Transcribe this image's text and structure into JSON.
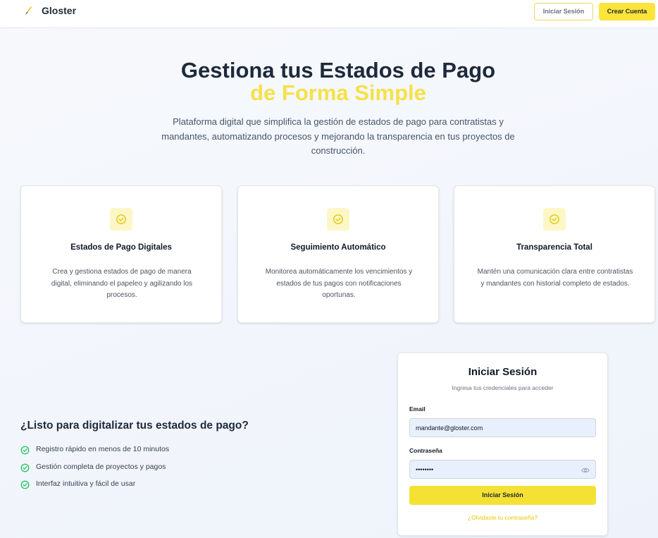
{
  "header": {
    "brand": "Gloster",
    "login_label": "Iniciar Sesión",
    "register_label": "Crear Cuenta"
  },
  "hero": {
    "title_line1": "Gestiona tus Estados de Pago",
    "title_line2": "de Forma Simple",
    "description": "Plataforma digital que simplifica la gestión de estados de pago para contratistas y mandantes, automatizando procesos y mejorando la transparencia en tus proyectos de construcción."
  },
  "features": [
    {
      "icon": "check-circle-icon",
      "title": "Estados de Pago Digitales",
      "description": "Crea y gestiona estados de pago de manera digital, eliminando el papeleo y agilizando los procesos."
    },
    {
      "icon": "check-circle-icon",
      "title": "Seguimiento Automático",
      "description": "Monitorea automáticamente los vencimientos y estados de tus pagos con notificaciones oportunas."
    },
    {
      "icon": "check-circle-icon",
      "title": "Transparencia Total",
      "description": "Mantén una comunicación clara entre contratistas y mandantes con historial completo de estados."
    }
  ],
  "cta": {
    "title": "¿Listo para digitalizar tus estados de pago?",
    "items": [
      "Registro rápido en menos de 10 minutos",
      "Gestión completa de proyectos y pagos",
      "Interfaz intuitiva y fácil de usar"
    ]
  },
  "login": {
    "title": "Iniciar Sesión",
    "subtitle": "Ingresa tus credenciales para acceder",
    "email_label": "Email",
    "email_value": "mandante@gloster.com",
    "password_label": "Contraseña",
    "password_value": "passwd12",
    "submit_label": "Iniciar Sesión",
    "forgot_label": "¿Olvidaste tu contraseña?"
  },
  "colors": {
    "accent": "#f5e133",
    "heading": "#1e293b",
    "check_green": "#22c55e"
  }
}
